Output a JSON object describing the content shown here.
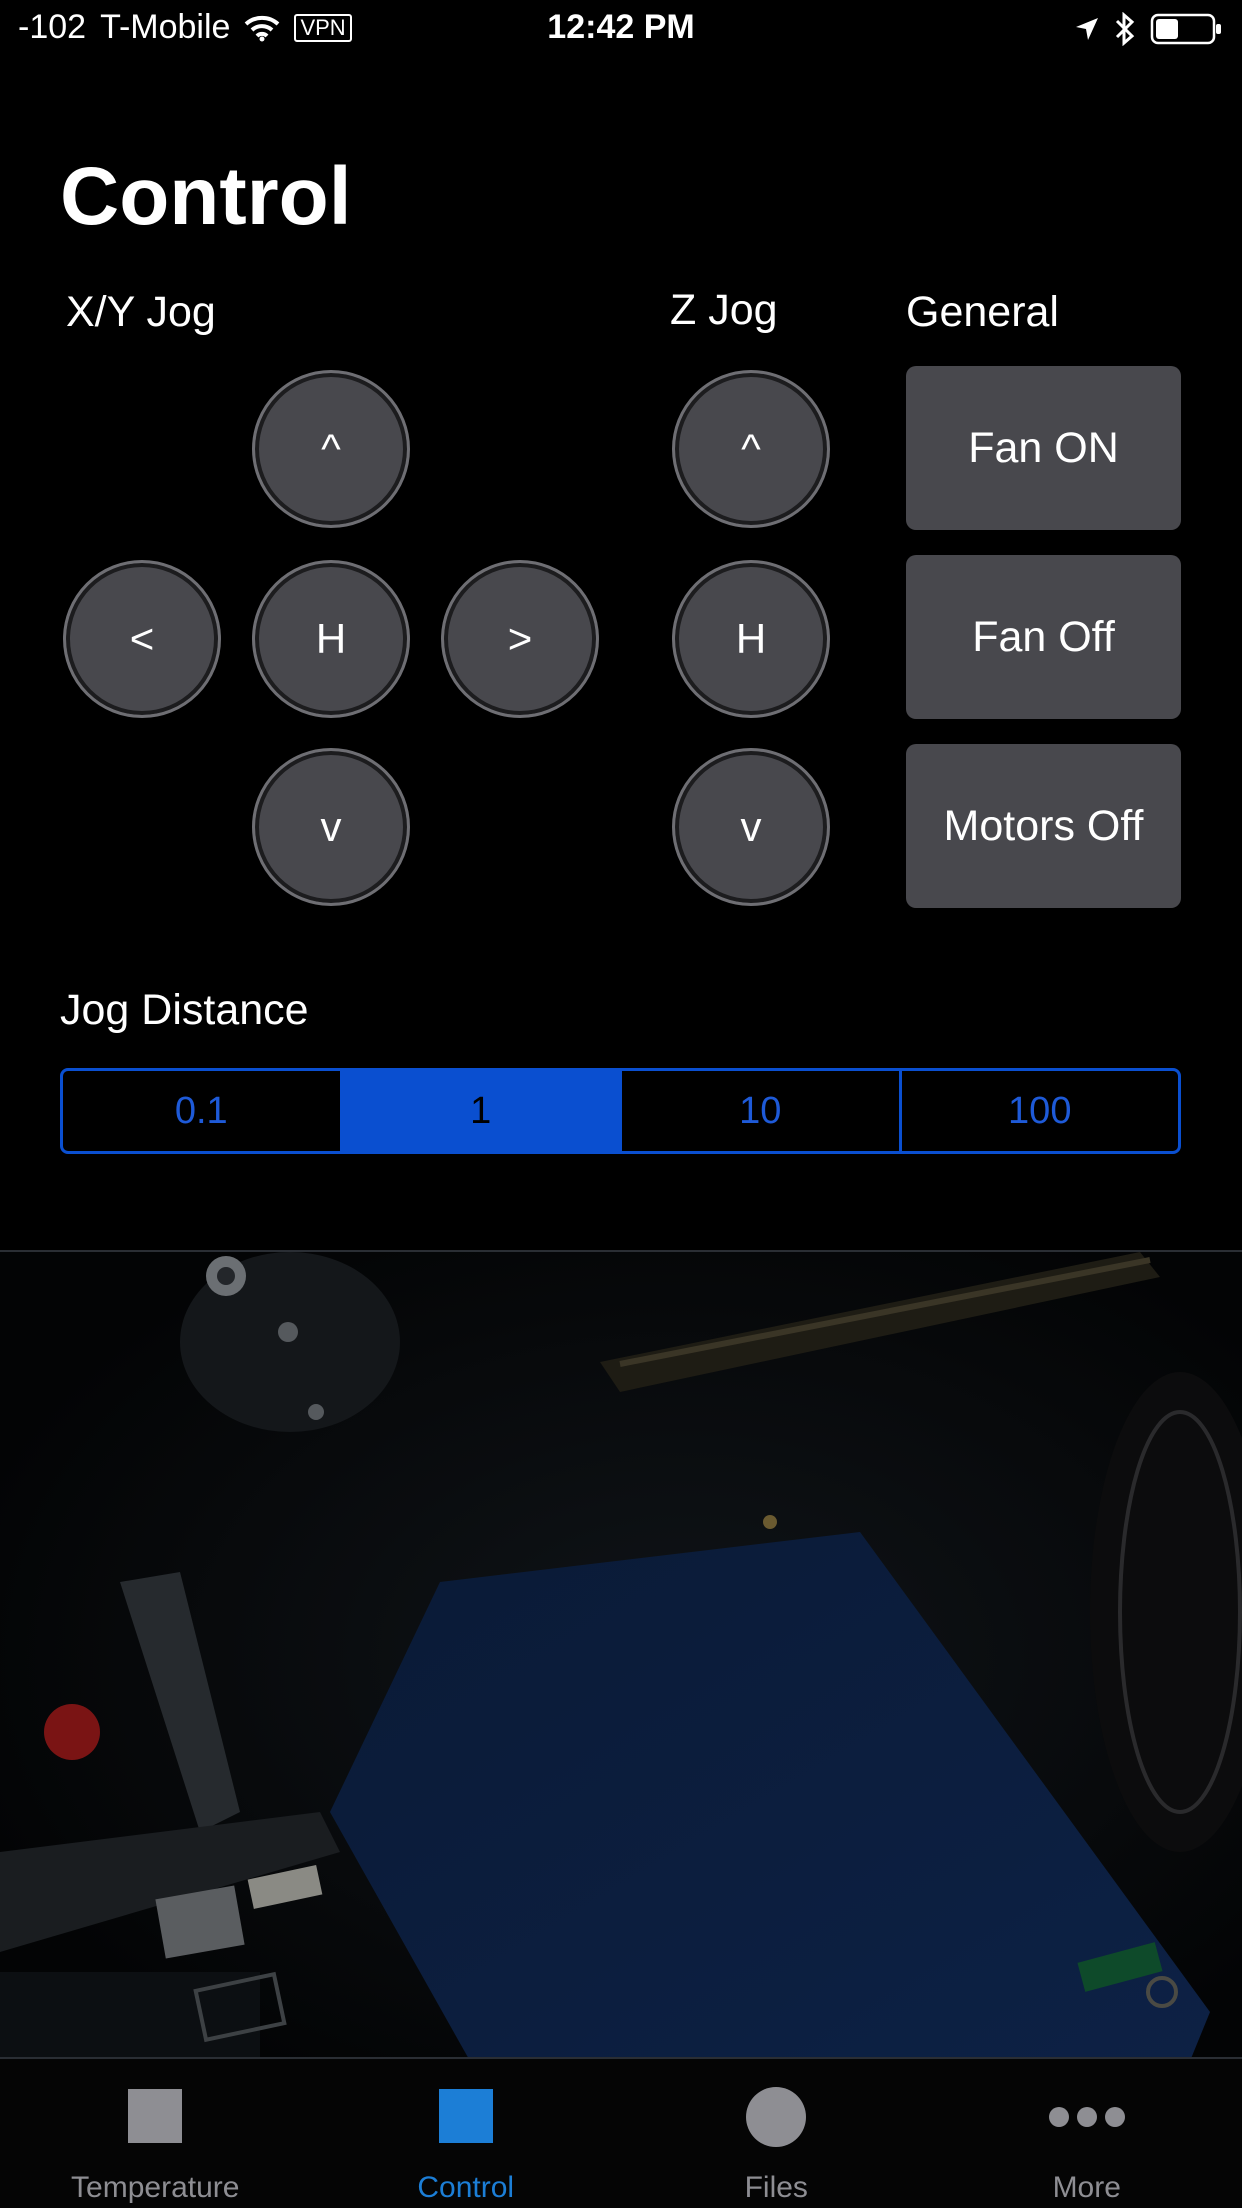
{
  "status_bar": {
    "signal": "-102",
    "carrier": "T-Mobile",
    "vpn_label": "VPN",
    "time": "12:42 PM"
  },
  "page": {
    "title": "Control"
  },
  "sections": {
    "xy": "X/Y Jog",
    "z": "Z Jog",
    "general": "General",
    "jog_distance": "Jog Distance"
  },
  "xy_jog": {
    "up": "^",
    "left": "<",
    "home": "H",
    "right": ">",
    "down": "v"
  },
  "z_jog": {
    "up": "^",
    "home": "H",
    "down": "v"
  },
  "general": {
    "fan_on": "Fan ON",
    "fan_off": "Fan Off",
    "motors_off": "Motors Off"
  },
  "jog_distance": {
    "options": [
      "0.1",
      "1",
      "10",
      "100"
    ],
    "selected": "1"
  },
  "tabs": [
    {
      "label": "Temperature",
      "icon": "square-icon",
      "active": false
    },
    {
      "label": "Control",
      "icon": "square-icon",
      "active": true
    },
    {
      "label": "Files",
      "icon": "circle-icon",
      "active": false
    },
    {
      "label": "More",
      "icon": "ellipsis-icon",
      "active": false
    }
  ],
  "colors": {
    "accent": "#0a4fd0",
    "tab_active": "#1c7ed6",
    "tab_inactive": "#8e8e93",
    "button_bg": "#48484d"
  }
}
